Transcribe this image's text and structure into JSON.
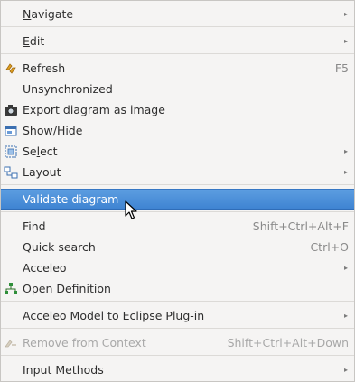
{
  "menu": {
    "items": [
      {
        "label": "Navigate",
        "mnemonic": "N",
        "rest": "avigate",
        "submenu": true
      },
      {
        "label": "Edit",
        "mnemonic": "E",
        "rest": "dit",
        "submenu": true
      },
      {
        "label": "Refresh",
        "shortcut": "F5",
        "icon": "refresh-icon"
      },
      {
        "label": "Unsynchronized"
      },
      {
        "label": "Export diagram as image",
        "icon": "camera-icon"
      },
      {
        "label": "Show/Hide",
        "icon": "show-hide-icon"
      },
      {
        "label": "Select",
        "pre": "Se",
        "mnemonic": "l",
        "rest": "ect",
        "submenu": true,
        "icon": "select-icon"
      },
      {
        "label": "Layout",
        "submenu": true,
        "icon": "layout-icon"
      },
      {
        "label": "Validate diagram",
        "active": true
      },
      {
        "label": "Find",
        "shortcut": "Shift+Ctrl+Alt+F"
      },
      {
        "label": "Quick search",
        "shortcut": "Ctrl+O"
      },
      {
        "label": "Acceleo",
        "submenu": true
      },
      {
        "label": "Open Definition",
        "icon": "hierarchy-icon"
      },
      {
        "label": "Acceleo Model to Eclipse Plug-in",
        "submenu": true
      },
      {
        "label": "Remove from Context",
        "shortcut": "Shift+Ctrl+Alt+Down",
        "disabled": true,
        "icon": "remove-context-icon"
      },
      {
        "label": "Input Methods",
        "submenu": true
      }
    ],
    "chevron": "▸"
  }
}
